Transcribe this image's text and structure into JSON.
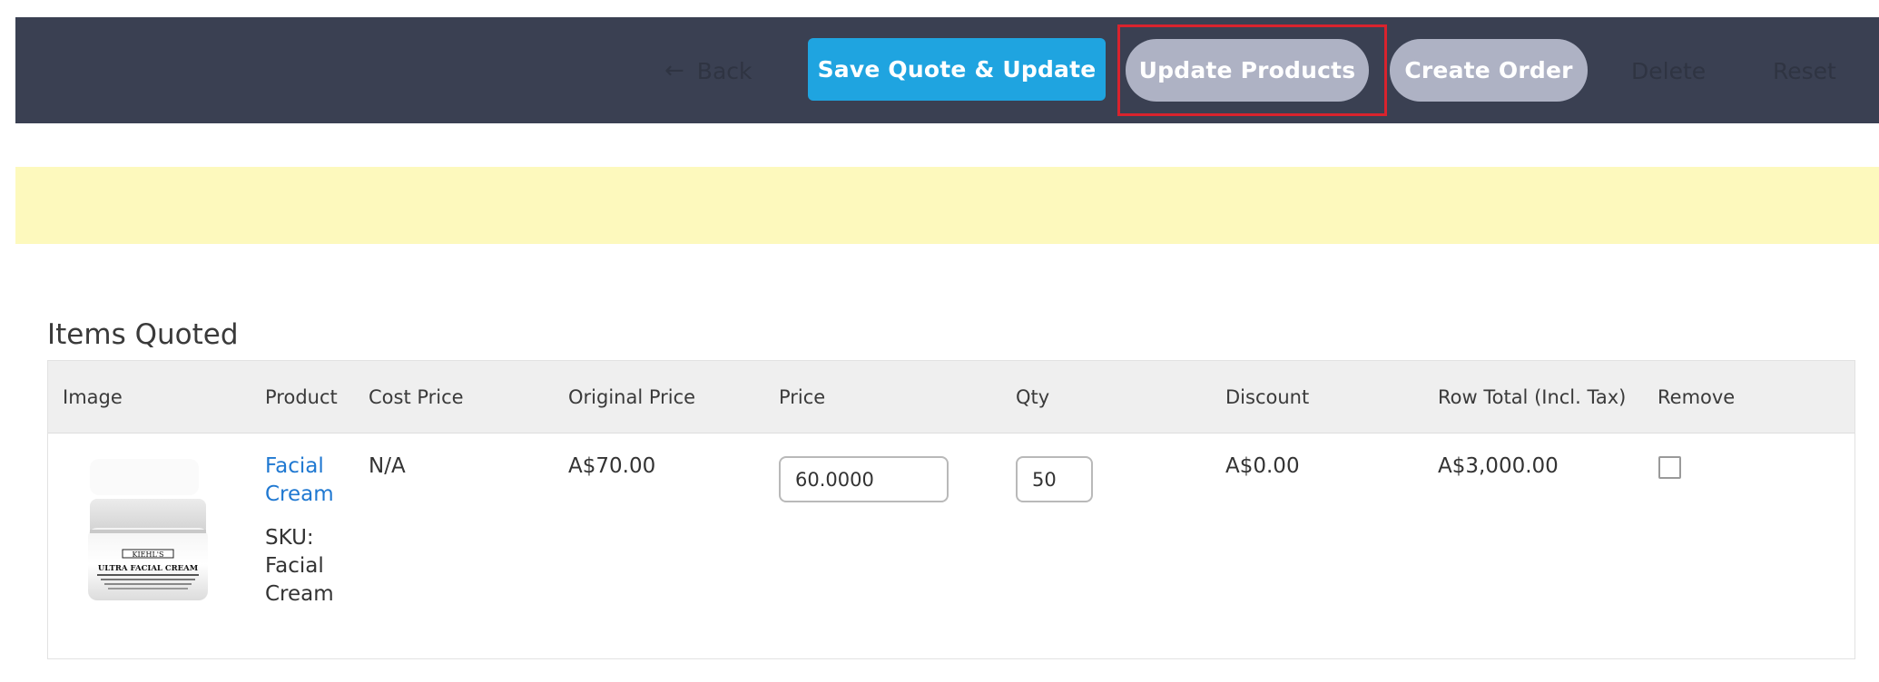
{
  "toolbar": {
    "back_arrow": "←",
    "back_label": "Back",
    "save_label": "Save Quote & Update",
    "update_products_label": "Update Products",
    "create_order_label": "Create Order",
    "delete_label": "Delete",
    "reset_label": "Reset"
  },
  "colors": {
    "toolbar_bg": "#3a4052",
    "primary_button": "#1fa4e0",
    "secondary_button": "#aeb2c4",
    "notice_bg": "#fdf9bd",
    "highlight": "#d9232d",
    "link": "#1f78d1"
  },
  "items_section": {
    "title": "Items Quoted",
    "columns": [
      "Image",
      "Product",
      "Cost Price",
      "Original Price",
      "Price",
      "Qty",
      "Discount",
      "Row Total (Incl. Tax)",
      "Remove"
    ],
    "rows": [
      {
        "image_label": "KIEHL'S",
        "image_sublabel": "ULTRA FACIAL CREAM",
        "product_name_line1": "Facial",
        "product_name_line2": "Cream",
        "sku_label": "SKU:",
        "sku_line1": "Facial",
        "sku_line2": "Cream",
        "cost_price": "N/A",
        "original_price": "A$70.00",
        "price": "60.0000",
        "qty": "50",
        "discount": "A$0.00",
        "row_total": "A$3,000.00",
        "remove_checked": false
      }
    ]
  }
}
